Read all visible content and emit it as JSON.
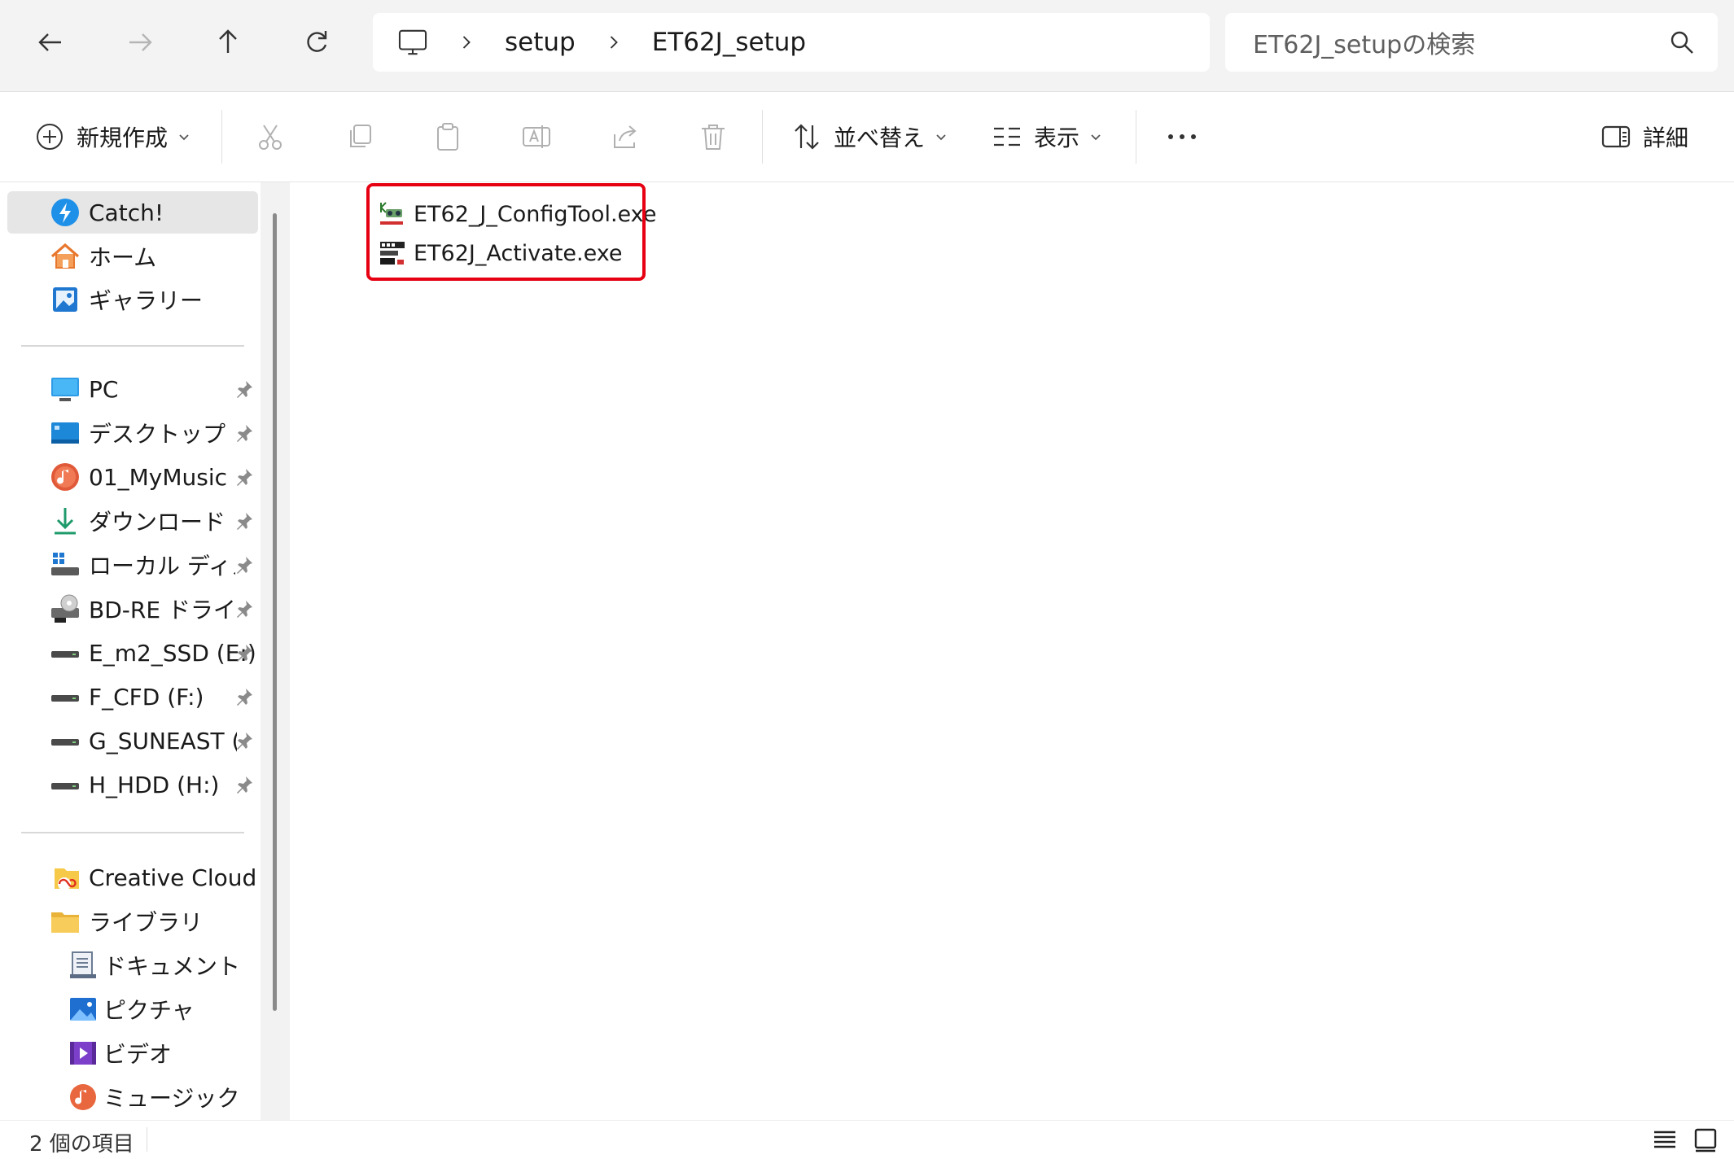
{
  "address_bar": {
    "breadcrumb": [
      "setup",
      "ET62J_setup"
    ],
    "search_placeholder": "ET62J_setupの検索"
  },
  "command_bar": {
    "new_label": "新規作成",
    "sort_label": "並べ替え",
    "view_label": "表示",
    "more_label": "…",
    "details_label": "詳細"
  },
  "sidebar": {
    "quick": [
      {
        "label": "Catch!",
        "icon": "catch-icon",
        "selected": true
      },
      {
        "label": "ホーム",
        "icon": "home-icon"
      },
      {
        "label": "ギャラリー",
        "icon": "gallery-icon"
      }
    ],
    "pinned": [
      {
        "label": "PC",
        "icon": "pc-icon"
      },
      {
        "label": "デスクトップ",
        "icon": "desktop-icon"
      },
      {
        "label": "01_MyMusic",
        "icon": "music-folder-icon"
      },
      {
        "label": "ダウンロード",
        "icon": "download-icon"
      },
      {
        "label": "ローカル ディスク",
        "icon": "local-disk-icon"
      },
      {
        "label": "BD-RE ドライブ (",
        "icon": "bd-drive-icon"
      },
      {
        "label": "E_m2_SSD (E:)",
        "icon": "drive-icon"
      },
      {
        "label": "F_CFD (F:)",
        "icon": "drive-icon"
      },
      {
        "label": "G_SUNEAST (G",
        "icon": "drive-icon"
      },
      {
        "label": "H_HDD (H:)",
        "icon": "drive-icon"
      }
    ],
    "libraries": [
      {
        "label": "Creative Cloud Fil",
        "icon": "creative-cloud-icon"
      },
      {
        "label": "ライブラリ",
        "icon": "library-folder-icon"
      },
      {
        "label": "ドキュメント",
        "icon": "documents-icon"
      },
      {
        "label": "ピクチャ",
        "icon": "pictures-icon"
      },
      {
        "label": "ビデオ",
        "icon": "videos-icon"
      },
      {
        "label": "ミュージック",
        "icon": "music-icon"
      }
    ]
  },
  "files": [
    {
      "name": "ET62_J_ConfigTool.exe",
      "icon": "config-tool-exe-icon"
    },
    {
      "name": "ET62J_Activate.exe",
      "icon": "activate-exe-icon"
    }
  ],
  "highlight_color": "#e60012",
  "status": {
    "item_count": "2 個の項目"
  }
}
